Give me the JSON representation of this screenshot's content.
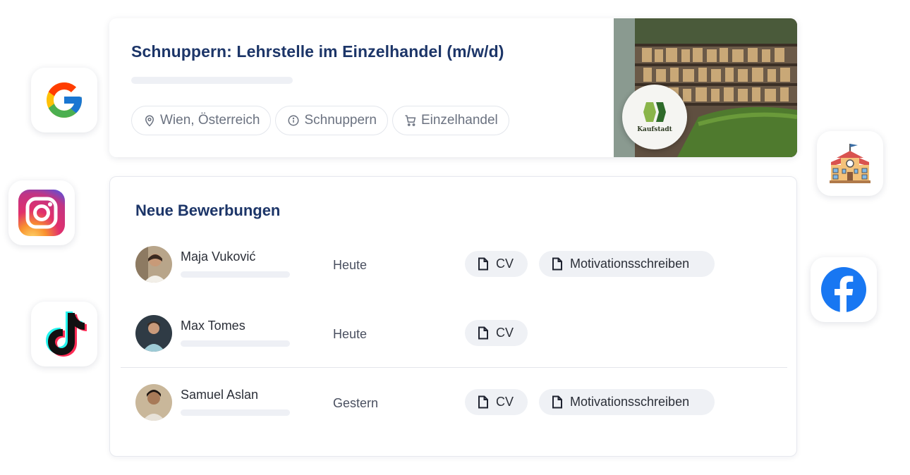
{
  "job": {
    "title": "Schnuppern: Lehrstelle im Einzelhandel (m/w/d)",
    "chips": [
      {
        "icon": "location-pin-icon",
        "label": "Wien, Österreich"
      },
      {
        "icon": "info-icon",
        "label": "Schnuppern"
      },
      {
        "icon": "shopping-cart-icon",
        "label": "Einzelhandel"
      }
    ],
    "company_logo_text": "Kaufstadt"
  },
  "applications": {
    "title": "Neue Bewerbungen",
    "rows": [
      {
        "name": "Maja Vuković",
        "date": "Heute",
        "documents": [
          "CV",
          "Motivationsschreiben"
        ]
      },
      {
        "name": "Max Tomes",
        "date": "Heute",
        "documents": [
          "CV"
        ]
      },
      {
        "name": "Samuel Aslan",
        "date": "Gestern",
        "documents": [
          "CV",
          "Motivationsschreiben"
        ]
      }
    ]
  },
  "social_icons": [
    "google-icon",
    "instagram-icon",
    "tiktok-icon",
    "school-icon",
    "facebook-icon"
  ],
  "colors": {
    "title": "#1c3568",
    "chip_bg": "#eff1f5",
    "skeleton": "#eef0f5"
  }
}
